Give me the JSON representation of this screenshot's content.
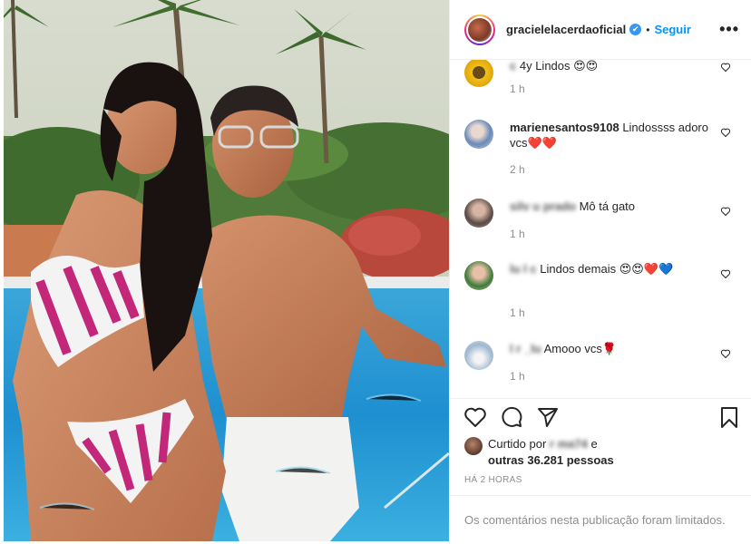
{
  "post": {
    "username": "gracielelacerdaoficial",
    "verified_mark": "✔",
    "separator": "•",
    "follow_label": "Seguir",
    "more_label": "•••"
  },
  "comments": [
    {
      "user": "c          ",
      "text": "4y Lindos 😍😍",
      "time": "1 h",
      "avatar": "sunflower"
    },
    {
      "user": "marienesantos9108",
      "text": "Lindossss adoro vcs❤️❤️",
      "time": "2 h",
      "avatar": "person-blue"
    },
    {
      "user": "silv    u prado",
      "text": "Mô tá gato",
      "time": "1 h",
      "avatar": "person-dark"
    },
    {
      "user": "lu    l    c",
      "text": "Lindos demais 😍😍❤️💙",
      "time": "1 h",
      "avatar": "person-green"
    },
    {
      "user": "l     r    _lu",
      "text": "Amooo vcs🌹",
      "time": "1 h",
      "avatar": "sky"
    }
  ],
  "likes": {
    "prefix": "Curtido por ",
    "user": "r        ma74",
    "connector": " e",
    "others": "outras 36.281 pessoas"
  },
  "posted_ago": "HÁ 2 HORAS",
  "comments_limited": "Os comentários nesta publicação foram limitados.",
  "icons": [
    "heart-icon",
    "comment-icon",
    "share-icon",
    "bookmark-icon"
  ],
  "colors": {
    "link": "#0095f6",
    "muted": "#8e8e8e",
    "text": "#262626"
  }
}
